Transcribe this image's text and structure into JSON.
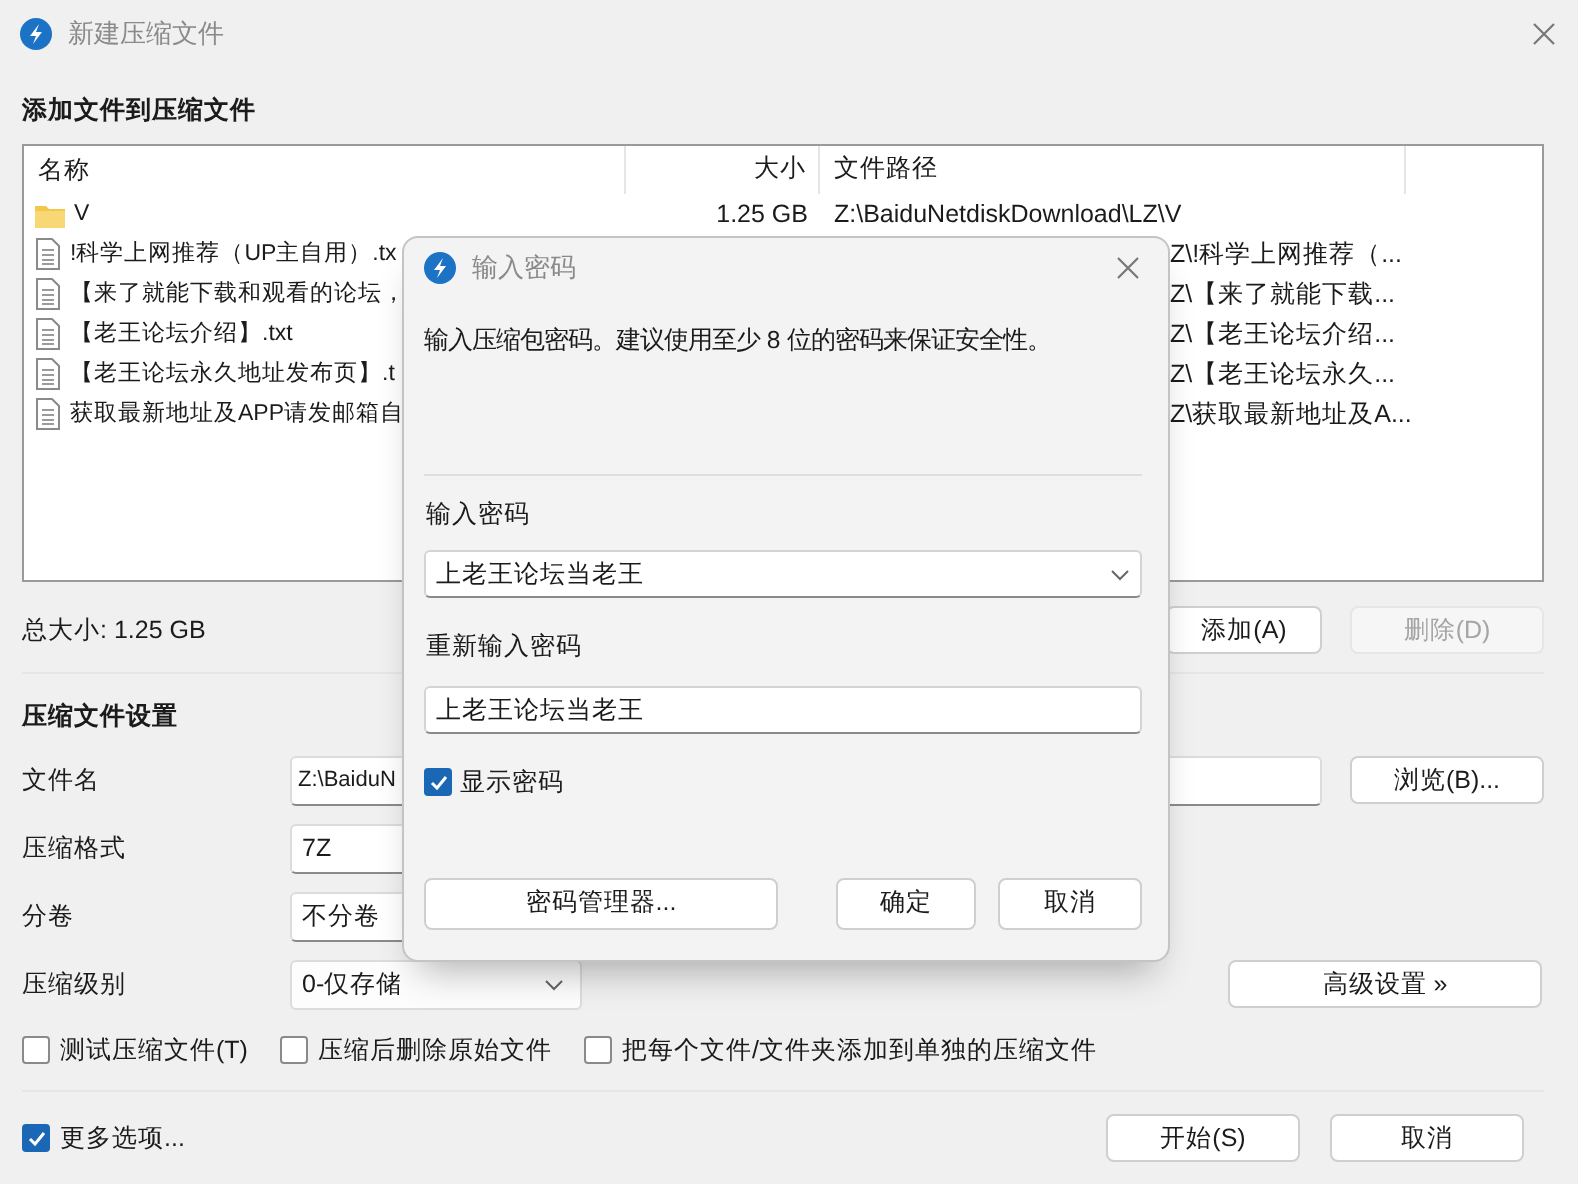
{
  "window": {
    "title": "新建压缩文件"
  },
  "files_section": {
    "title": "添加文件到压缩文件",
    "columns": [
      "名称",
      "大小",
      "文件路径"
    ],
    "rows": [
      {
        "kind": "folder",
        "name": "V",
        "size": "1.25 GB",
        "path": "Z:\\BaiduNetdiskDownload\\LZ\\V"
      },
      {
        "kind": "text-file",
        "name": "!科学上网推荐（UP主自用）.tx",
        "path": "Z\\!科学上网推荐（..."
      },
      {
        "kind": "text-file",
        "name": "【来了就能下载和观看的论坛，",
        "path": "Z\\【来了就能下载..."
      },
      {
        "kind": "text-file",
        "name": "【老王论坛介绍】.txt",
        "path": "Z\\【老王论坛介绍..."
      },
      {
        "kind": "text-file",
        "name": "【老王论坛永久地址发布页】.t",
        "path": "Z\\【老王论坛永久..."
      },
      {
        "kind": "text-file",
        "name": "获取最新地址及APP请发邮箱自",
        "path": "Z\\获取最新地址及A..."
      }
    ]
  },
  "total_size": "总大小: 1.25 GB",
  "list_buttons": [
    {
      "label": "添加(A)",
      "disabled": false
    },
    {
      "label": "删除(D)",
      "disabled": true
    }
  ],
  "settings": {
    "title": "压缩文件设置",
    "fields": [
      {
        "kind": "text",
        "label": "文件名",
        "value": "Z:\\BaiduN",
        "button": "浏览(B)..."
      },
      {
        "kind": "field",
        "label": "压缩格式",
        "value": "7Z"
      },
      {
        "kind": "field",
        "label": "分卷",
        "value": "不分卷"
      },
      {
        "kind": "combo",
        "label": "压缩级别",
        "value": "0-仅存储",
        "button": "高级设置 »"
      }
    ],
    "options": [
      {
        "label": "测试压缩文件(T)",
        "checked": false
      },
      {
        "label": "压缩后删除原始文件",
        "checked": false
      },
      {
        "label": "把每个文件/文件夹添加到单独的压缩文件",
        "checked": false
      }
    ]
  },
  "more_options": {
    "label": "更多选项...",
    "checked": true
  },
  "buttons": [
    "开始(S)",
    "取消"
  ],
  "password_dialog": {
    "title": "输入密码",
    "message": "输入压缩包密码。建议使用至少 8 位的密码来保证安全性。",
    "password_label": "输入密码",
    "password": "上老王论坛当老王",
    "confirm_label": "重新输入密码",
    "confirm": "上老王论坛当老王",
    "show_password": {
      "label": "显示密码",
      "checked": true
    },
    "manager_button": "密码管理器...",
    "buttons": [
      "确定",
      "取消"
    ]
  }
}
